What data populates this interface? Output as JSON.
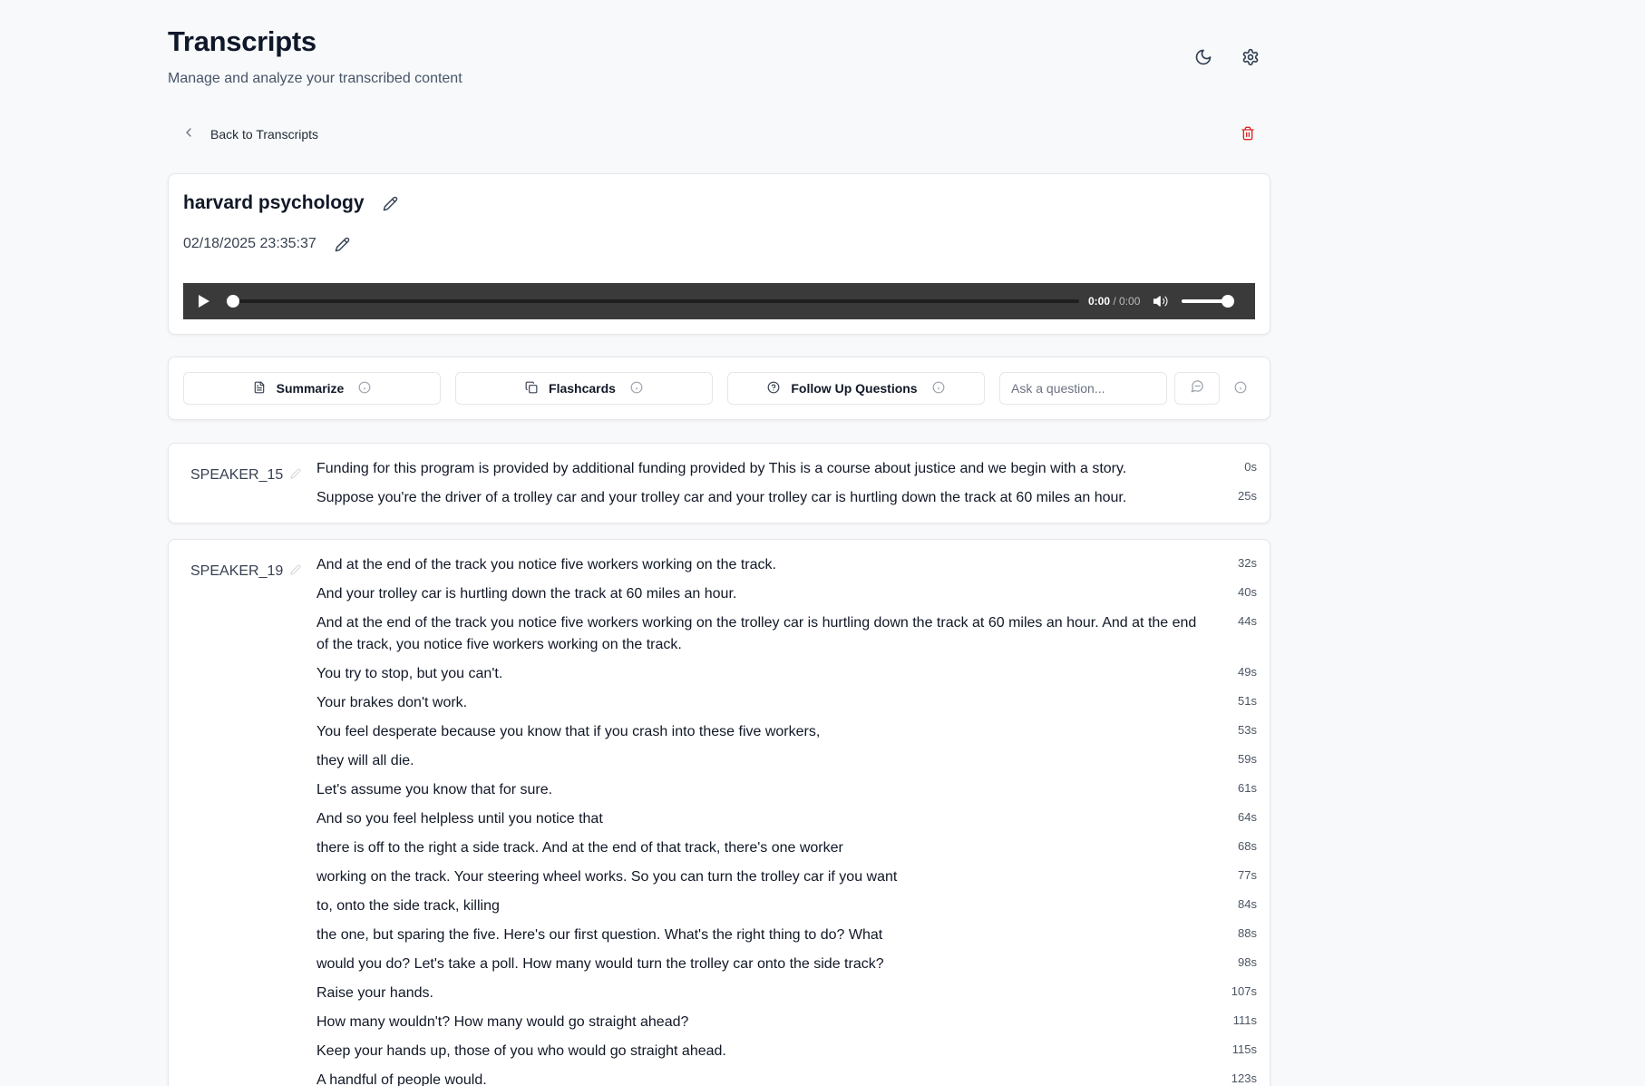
{
  "header": {
    "title": "Transcripts",
    "subtitle": "Manage and analyze your transcribed content"
  },
  "nav": {
    "back_label": "Back to Transcripts"
  },
  "transcript": {
    "title": "harvard psychology",
    "date": "02/18/2025 23:35:37"
  },
  "player": {
    "current_time": "0:00",
    "separator": " / ",
    "duration": "0:00",
    "progress": 0,
    "volume": 1
  },
  "actions": {
    "summarize": "Summarize",
    "flashcards": "Flashcards",
    "follow_up": "Follow Up Questions",
    "ask_placeholder": "Ask a question..."
  },
  "segments": [
    {
      "speaker": "SPEAKER_15",
      "lines": [
        {
          "text": "Funding for this program is provided by additional funding provided by This is a course about justice and we begin with a story.",
          "ts": "0s"
        },
        {
          "text": "Suppose you're the driver of a trolley car and your trolley car and your trolley car is hurtling down the track at 60 miles an hour.",
          "ts": "25s"
        }
      ]
    },
    {
      "speaker": "SPEAKER_19",
      "lines": [
        {
          "text": "And at the end of the track you notice five workers working on the track.",
          "ts": "32s"
        },
        {
          "text": "And your trolley car is hurtling down the track at 60 miles an hour.",
          "ts": "40s"
        },
        {
          "text": "And at the end of the track you notice five workers working on the trolley car is hurtling down the track at 60 miles an hour. And at the end of the track, you notice five workers working on the track.",
          "ts": "44s"
        },
        {
          "text": "You try to stop, but you can't.",
          "ts": "49s"
        },
        {
          "text": "Your brakes don't work.",
          "ts": "51s"
        },
        {
          "text": "You feel desperate because you know that if you crash into these five workers,",
          "ts": "53s"
        },
        {
          "text": "they will all die.",
          "ts": "59s"
        },
        {
          "text": "Let's assume you know that for sure.",
          "ts": "61s"
        },
        {
          "text": "And so you feel helpless until you notice that",
          "ts": "64s"
        },
        {
          "text": "there is off to the right a side track. And at the end of that track, there's one worker",
          "ts": "68s"
        },
        {
          "text": "working on the track. Your steering wheel works. So you can turn the trolley car if you want",
          "ts": "77s"
        },
        {
          "text": "to, onto the side track, killing",
          "ts": "84s"
        },
        {
          "text": "the one, but sparing the five. Here's our first question. What's the right thing to do? What",
          "ts": "88s"
        },
        {
          "text": "would you do? Let's take a poll. How many would turn the trolley car onto the side track?",
          "ts": "98s"
        },
        {
          "text": "Raise your hands.",
          "ts": "107s"
        },
        {
          "text": "How many wouldn't? How many would go straight ahead?",
          "ts": "111s"
        },
        {
          "text": "Keep your hands up, those of you who would go straight ahead.",
          "ts": "115s"
        },
        {
          "text": "A handful of people would.",
          "ts": "123s"
        }
      ]
    }
  ]
}
